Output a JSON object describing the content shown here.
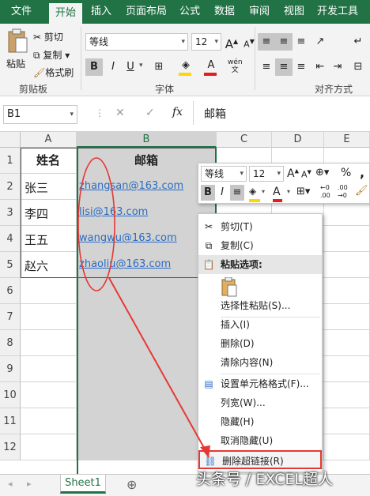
{
  "ribbon_tabs": [
    "文件",
    "开始",
    "插入",
    "页面布局",
    "公式",
    "数据",
    "审阅",
    "视图",
    "开发工具"
  ],
  "clipboard": {
    "paste": "粘贴",
    "cut": "剪切",
    "copy": "复制",
    "format_painter": "格式刷",
    "group": "剪贴板"
  },
  "font": {
    "name": "等线",
    "size": "12",
    "grow": "A",
    "shrink": "A",
    "bold": "B",
    "italic": "I",
    "underline": "U",
    "wen": "wén",
    "group": "字体"
  },
  "align": {
    "group": "对齐方式"
  },
  "formula_bar": {
    "name_box": "B1",
    "cancel": "✕",
    "confirm": "✓",
    "fx": "fx",
    "value": "邮箱"
  },
  "columns": [
    "A",
    "B",
    "C",
    "D",
    "E"
  ],
  "rows": [
    "1",
    "2",
    "3",
    "4",
    "5",
    "6",
    "7",
    "8",
    "9",
    "10",
    "11",
    "12"
  ],
  "table": {
    "header": [
      "姓名",
      "邮箱"
    ],
    "data": [
      [
        "张三",
        "zhangsan@163.com"
      ],
      [
        "李四",
        "lisi@163.com"
      ],
      [
        "王五",
        "wangwu@163.com"
      ],
      [
        "赵六",
        "zhaoliu@163.com"
      ]
    ]
  },
  "mini_toolbar": {
    "font": "等线",
    "size": "12",
    "percent": "%",
    "comma": ",",
    "bold": "B",
    "italic": "I",
    "font_color": "A",
    "inc_decimal": ".00",
    "dec_decimal": ".00"
  },
  "context_menu": [
    {
      "icon": "scissors-icon",
      "label": "剪切(T)"
    },
    {
      "icon": "copy-icon",
      "label": "复制(C)"
    },
    {
      "icon": "paste-icon",
      "label": "粘贴选项:"
    },
    {
      "icon": "",
      "label": "选择性粘贴(S)..."
    },
    {
      "icon": "",
      "label": "插入(I)"
    },
    {
      "icon": "",
      "label": "删除(D)"
    },
    {
      "icon": "",
      "label": "清除内容(N)"
    },
    {
      "icon": "format-cells-icon",
      "label": "设置单元格格式(F)..."
    },
    {
      "icon": "",
      "label": "列宽(W)..."
    },
    {
      "icon": "",
      "label": "隐藏(H)"
    },
    {
      "icon": "",
      "label": "取消隐藏(U)"
    },
    {
      "icon": "remove-link-icon",
      "label": "删除超链接(R)"
    }
  ],
  "sheet": {
    "tab": "Sheet1",
    "add": "⊕"
  },
  "watermark": "头条号 / EXCEL超人",
  "colors": {
    "excel_green": "#217346",
    "highlight_yellow": "#ffd700",
    "font_red": "#e02020",
    "annotation_red": "#e53935"
  }
}
